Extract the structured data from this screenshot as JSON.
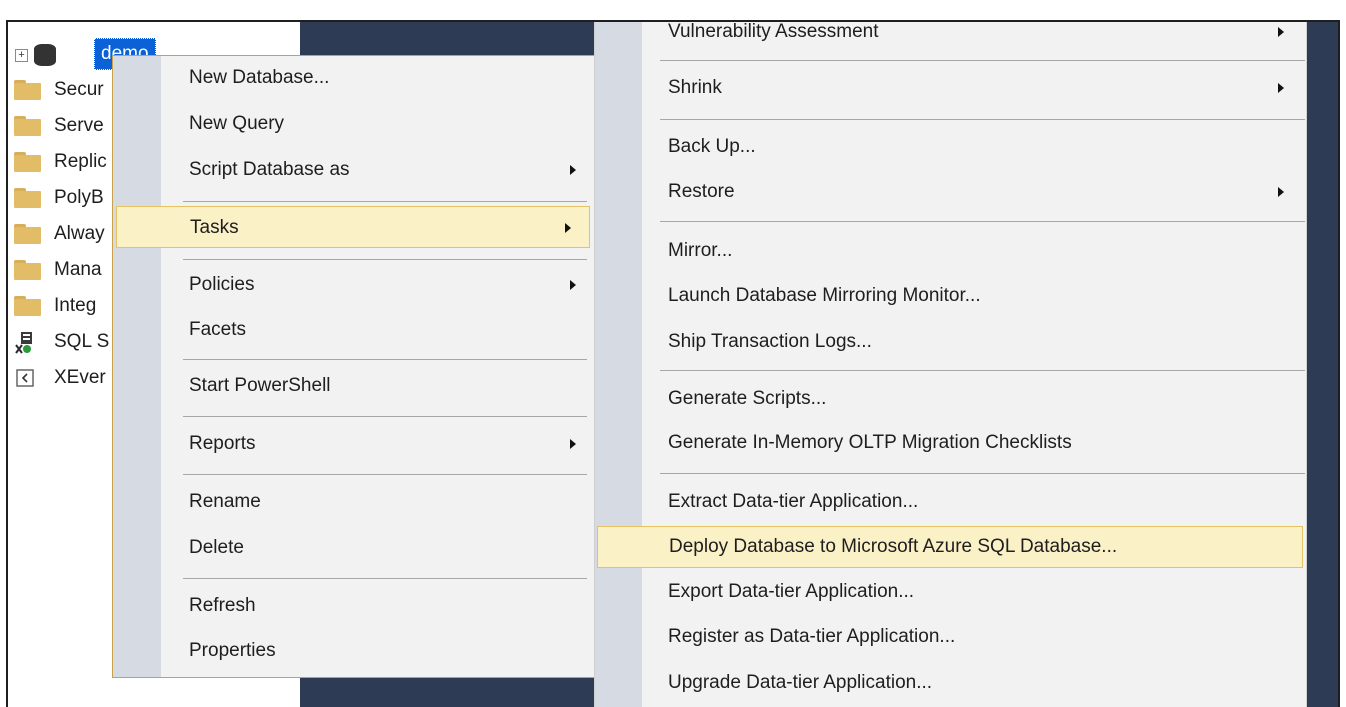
{
  "tree": {
    "root_label": "demo",
    "items": [
      {
        "label": "Secur",
        "icon": "folder-icon"
      },
      {
        "label": "Serve",
        "icon": "folder-icon"
      },
      {
        "label": "Replic",
        "icon": "folder-icon"
      },
      {
        "label": "PolyB",
        "icon": "folder-icon"
      },
      {
        "label": "Alway",
        "icon": "folder-icon"
      },
      {
        "label": "Mana",
        "icon": "folder-icon"
      },
      {
        "label": "Integ",
        "icon": "folder-icon"
      },
      {
        "label": "SQL S",
        "icon": "sql-agent-icon"
      },
      {
        "label": "XEver",
        "icon": "xevent-icon"
      }
    ]
  },
  "context_menu": {
    "items": [
      {
        "label": "New Database...",
        "has_submenu": false
      },
      {
        "label": "New Query",
        "has_submenu": false
      },
      {
        "label": "Script Database as",
        "has_submenu": true
      },
      {
        "label": "Tasks",
        "has_submenu": true,
        "highlighted": true
      },
      {
        "label": "Policies",
        "has_submenu": true
      },
      {
        "label": "Facets",
        "has_submenu": false
      },
      {
        "label": "Start PowerShell",
        "has_submenu": false
      },
      {
        "label": "Reports",
        "has_submenu": true
      },
      {
        "label": "Rename",
        "has_submenu": false
      },
      {
        "label": "Delete",
        "has_submenu": false
      },
      {
        "label": "Refresh",
        "has_submenu": false
      },
      {
        "label": "Properties",
        "has_submenu": false
      }
    ]
  },
  "tasks_submenu": {
    "items": [
      {
        "label": "Vulnerability Assessment",
        "has_submenu": true
      },
      {
        "label": "Shrink",
        "has_submenu": true
      },
      {
        "label": "Back Up...",
        "has_submenu": false
      },
      {
        "label": "Restore",
        "has_submenu": true
      },
      {
        "label": "Mirror...",
        "has_submenu": false
      },
      {
        "label": "Launch Database Mirroring Monitor...",
        "has_submenu": false
      },
      {
        "label": "Ship Transaction Logs...",
        "has_submenu": false
      },
      {
        "label": "Generate Scripts...",
        "has_submenu": false
      },
      {
        "label": "Generate In-Memory OLTP Migration Checklists",
        "has_submenu": false
      },
      {
        "label": "Extract Data-tier Application...",
        "has_submenu": false
      },
      {
        "label": "Deploy Database to Microsoft Azure SQL Database...",
        "has_submenu": false,
        "highlighted": true
      },
      {
        "label": "Export Data-tier Application...",
        "has_submenu": false
      },
      {
        "label": "Register as Data-tier Application...",
        "has_submenu": false
      },
      {
        "label": "Upgrade Data-tier Application...",
        "has_submenu": false
      }
    ]
  },
  "colors": {
    "selection_blue": "#0a62d6",
    "menu_highlight": "#fbf1c7",
    "menu_highlight_border": "#e5c365",
    "background_dark": "#2d3b54",
    "menu_background": "#f2f2f2",
    "menu_gutter": "#d6dae3"
  }
}
